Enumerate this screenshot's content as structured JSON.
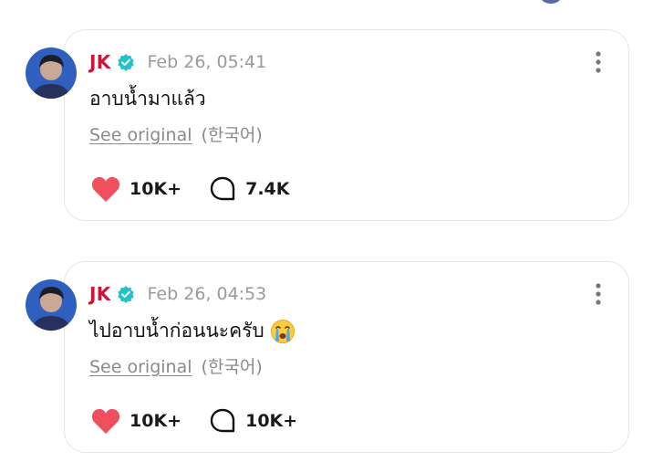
{
  "colors": {
    "author": "#c7183a",
    "verified": "#1fc3c9",
    "heart": "#f0505e",
    "muted": "#9a9a9a"
  },
  "posts": [
    {
      "author": "JK",
      "verified_icon": "verified-badge-icon",
      "timestamp": "Feb 26, 05:41",
      "text": "อาบน้ำมาแล้ว",
      "see_original": "See original",
      "language": "(한국어)",
      "likes": "10K+",
      "comments": "7.4K"
    },
    {
      "author": "JK",
      "verified_icon": "verified-badge-icon",
      "timestamp": "Feb 26, 04:53",
      "text": "ไปอาบน้ำก่อนนะครับ",
      "emoji": "crying-face-emoji",
      "see_original": "See original",
      "language": "(한국어)",
      "likes": "10K+",
      "comments": "10K+"
    }
  ]
}
